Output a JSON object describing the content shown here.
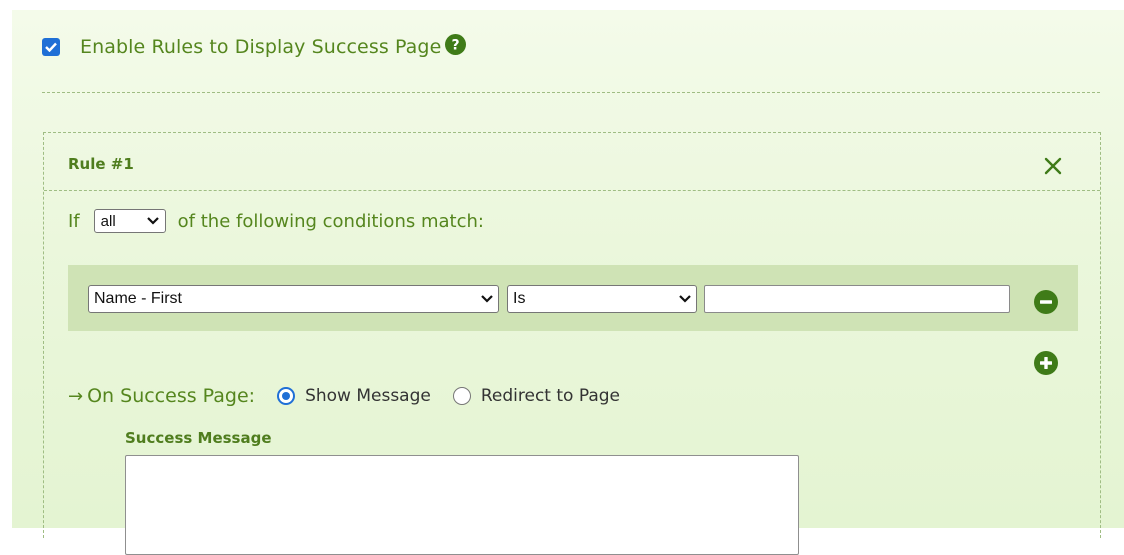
{
  "enable": {
    "label": "Enable Rules to Display Success Page",
    "checked": true,
    "help_icon": "question-circle-icon"
  },
  "rule": {
    "title": "Rule #1",
    "remove_icon": "close-icon",
    "condition": {
      "prefix": "If",
      "match_value": "all",
      "suffix": "of the following conditions match:"
    },
    "row": {
      "field_value": "Name - First",
      "operator_value": "Is",
      "value": "",
      "remove_icon": "minus-circle-icon"
    },
    "add_icon": "plus-circle-icon",
    "success": {
      "label": "On Success Page:",
      "arrow": "→",
      "options": [
        {
          "label": "Show Message",
          "selected": true
        },
        {
          "label": "Redirect to Page",
          "selected": false
        }
      ],
      "message_label": "Success Message",
      "message_value": ""
    }
  },
  "colors": {
    "accent_green": "#4f7d1e",
    "icon_green": "#3f7b18",
    "checkbox_blue": "#1f6fd6",
    "row_bg": "#cfe3b5"
  }
}
